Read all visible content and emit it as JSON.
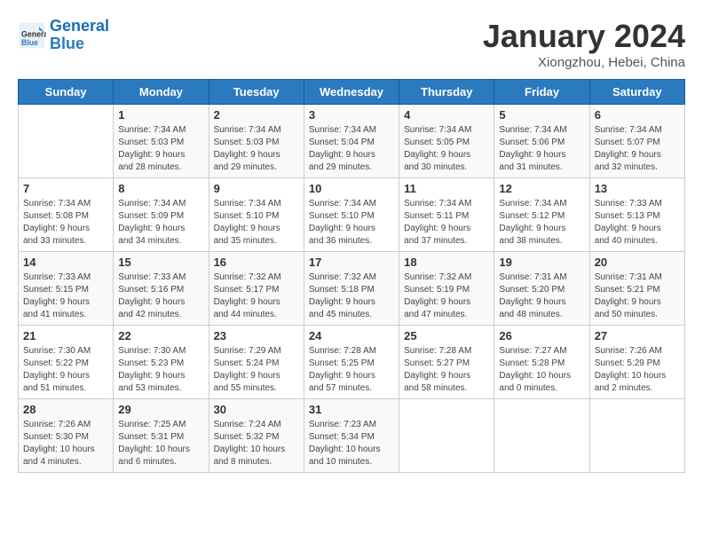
{
  "header": {
    "logo_line1": "General",
    "logo_line2": "Blue",
    "month_title": "January 2024",
    "subtitle": "Xiongzhou, Hebei, China"
  },
  "weekdays": [
    "Sunday",
    "Monday",
    "Tuesday",
    "Wednesday",
    "Thursday",
    "Friday",
    "Saturday"
  ],
  "weeks": [
    [
      {
        "day": "",
        "info": ""
      },
      {
        "day": "1",
        "info": "Sunrise: 7:34 AM\nSunset: 5:03 PM\nDaylight: 9 hours\nand 28 minutes."
      },
      {
        "day": "2",
        "info": "Sunrise: 7:34 AM\nSunset: 5:03 PM\nDaylight: 9 hours\nand 29 minutes."
      },
      {
        "day": "3",
        "info": "Sunrise: 7:34 AM\nSunset: 5:04 PM\nDaylight: 9 hours\nand 29 minutes."
      },
      {
        "day": "4",
        "info": "Sunrise: 7:34 AM\nSunset: 5:05 PM\nDaylight: 9 hours\nand 30 minutes."
      },
      {
        "day": "5",
        "info": "Sunrise: 7:34 AM\nSunset: 5:06 PM\nDaylight: 9 hours\nand 31 minutes."
      },
      {
        "day": "6",
        "info": "Sunrise: 7:34 AM\nSunset: 5:07 PM\nDaylight: 9 hours\nand 32 minutes."
      }
    ],
    [
      {
        "day": "7",
        "info": "Sunrise: 7:34 AM\nSunset: 5:08 PM\nDaylight: 9 hours\nand 33 minutes."
      },
      {
        "day": "8",
        "info": "Sunrise: 7:34 AM\nSunset: 5:09 PM\nDaylight: 9 hours\nand 34 minutes."
      },
      {
        "day": "9",
        "info": "Sunrise: 7:34 AM\nSunset: 5:10 PM\nDaylight: 9 hours\nand 35 minutes."
      },
      {
        "day": "10",
        "info": "Sunrise: 7:34 AM\nSunset: 5:10 PM\nDaylight: 9 hours\nand 36 minutes."
      },
      {
        "day": "11",
        "info": "Sunrise: 7:34 AM\nSunset: 5:11 PM\nDaylight: 9 hours\nand 37 minutes."
      },
      {
        "day": "12",
        "info": "Sunrise: 7:34 AM\nSunset: 5:12 PM\nDaylight: 9 hours\nand 38 minutes."
      },
      {
        "day": "13",
        "info": "Sunrise: 7:33 AM\nSunset: 5:13 PM\nDaylight: 9 hours\nand 40 minutes."
      }
    ],
    [
      {
        "day": "14",
        "info": "Sunrise: 7:33 AM\nSunset: 5:15 PM\nDaylight: 9 hours\nand 41 minutes."
      },
      {
        "day": "15",
        "info": "Sunrise: 7:33 AM\nSunset: 5:16 PM\nDaylight: 9 hours\nand 42 minutes."
      },
      {
        "day": "16",
        "info": "Sunrise: 7:32 AM\nSunset: 5:17 PM\nDaylight: 9 hours\nand 44 minutes."
      },
      {
        "day": "17",
        "info": "Sunrise: 7:32 AM\nSunset: 5:18 PM\nDaylight: 9 hours\nand 45 minutes."
      },
      {
        "day": "18",
        "info": "Sunrise: 7:32 AM\nSunset: 5:19 PM\nDaylight: 9 hours\nand 47 minutes."
      },
      {
        "day": "19",
        "info": "Sunrise: 7:31 AM\nSunset: 5:20 PM\nDaylight: 9 hours\nand 48 minutes."
      },
      {
        "day": "20",
        "info": "Sunrise: 7:31 AM\nSunset: 5:21 PM\nDaylight: 9 hours\nand 50 minutes."
      }
    ],
    [
      {
        "day": "21",
        "info": "Sunrise: 7:30 AM\nSunset: 5:22 PM\nDaylight: 9 hours\nand 51 minutes."
      },
      {
        "day": "22",
        "info": "Sunrise: 7:30 AM\nSunset: 5:23 PM\nDaylight: 9 hours\nand 53 minutes."
      },
      {
        "day": "23",
        "info": "Sunrise: 7:29 AM\nSunset: 5:24 PM\nDaylight: 9 hours\nand 55 minutes."
      },
      {
        "day": "24",
        "info": "Sunrise: 7:28 AM\nSunset: 5:25 PM\nDaylight: 9 hours\nand 57 minutes."
      },
      {
        "day": "25",
        "info": "Sunrise: 7:28 AM\nSunset: 5:27 PM\nDaylight: 9 hours\nand 58 minutes."
      },
      {
        "day": "26",
        "info": "Sunrise: 7:27 AM\nSunset: 5:28 PM\nDaylight: 10 hours\nand 0 minutes."
      },
      {
        "day": "27",
        "info": "Sunrise: 7:26 AM\nSunset: 5:29 PM\nDaylight: 10 hours\nand 2 minutes."
      }
    ],
    [
      {
        "day": "28",
        "info": "Sunrise: 7:26 AM\nSunset: 5:30 PM\nDaylight: 10 hours\nand 4 minutes."
      },
      {
        "day": "29",
        "info": "Sunrise: 7:25 AM\nSunset: 5:31 PM\nDaylight: 10 hours\nand 6 minutes."
      },
      {
        "day": "30",
        "info": "Sunrise: 7:24 AM\nSunset: 5:32 PM\nDaylight: 10 hours\nand 8 minutes."
      },
      {
        "day": "31",
        "info": "Sunrise: 7:23 AM\nSunset: 5:34 PM\nDaylight: 10 hours\nand 10 minutes."
      },
      {
        "day": "",
        "info": ""
      },
      {
        "day": "",
        "info": ""
      },
      {
        "day": "",
        "info": ""
      }
    ]
  ]
}
